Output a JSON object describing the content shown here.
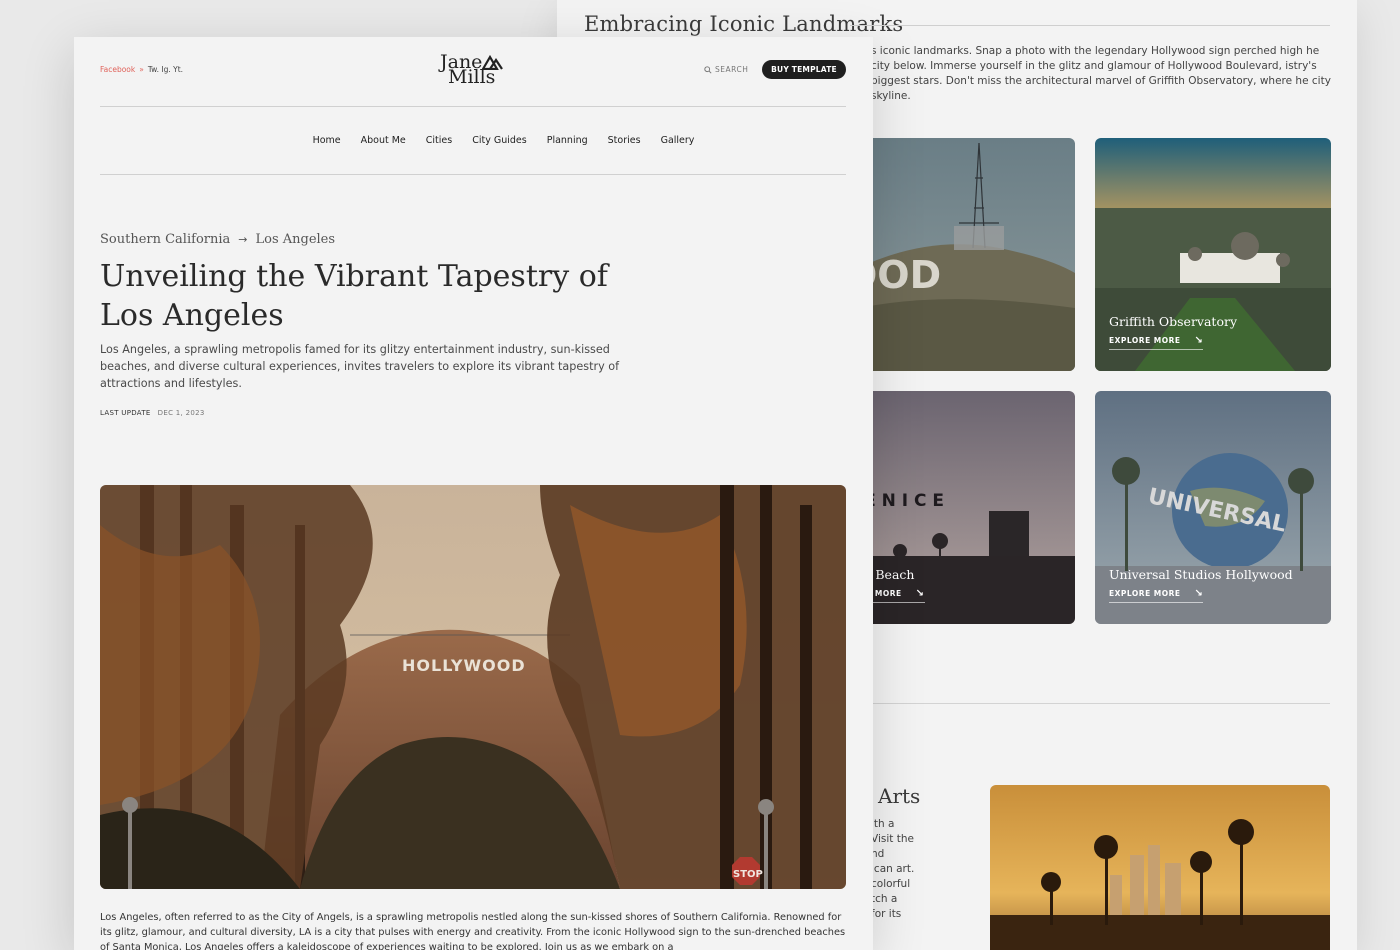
{
  "back": {
    "heading": "Embracing Iconic Landmarks",
    "paragraph": "s iconic landmarks. Snap a photo with the legendary Hollywood sign perched high he city below. Immerse yourself in the glitz and glamour of Hollywood Boulevard, istry's biggest stars. Don't miss the architectural marvel of Griffith Observatory, where he city skyline.",
    "cards": [
      {
        "title": "",
        "explore": ""
      },
      {
        "title": "Griffith Observatory",
        "explore": "EXPLORE MORE"
      },
      {
        "title": "ice Beach",
        "explore": "ORE MORE"
      },
      {
        "title": "Universal Studios Hollywood",
        "explore": "EXPLORE MORE"
      }
    ],
    "sign_text": "OOD",
    "venice_text": "V E N I C E",
    "universal_text": "UNIVERSAL",
    "arts_heading": "Arts",
    "arts_lines": [
      "ith a",
      "Visit the",
      "nd",
      "ican art.",
      "colorful",
      "tch a",
      "for its"
    ]
  },
  "front": {
    "social": {
      "facebook": "Facebook",
      "sep": "»",
      "others": "Tw. Ig. Yt."
    },
    "logo": {
      "line1": "Jane",
      "line2": "Mills"
    },
    "search_label": "SEARCH",
    "buy_label": "BUY TEMPLATE",
    "nav": [
      "Home",
      "About Me",
      "Cities",
      "City Guides",
      "Planning",
      "Stories",
      "Gallery"
    ],
    "breadcrumb": {
      "parent": "Southern California",
      "current": "Los Angeles"
    },
    "title": "Unveiling the Vibrant Tapestry of Los Angeles",
    "lead": "Los Angeles, a sprawling metropolis famed for its glitzy entertainment industry, sun-kissed beaches, and diverse cultural experiences, invites travelers to explore its vibrant tapestry of attractions and lifestyles.",
    "last_update_label": "LAST UPDATE",
    "last_update_date": "DEC 1, 2023",
    "hero_sign": "HOLLYWOOD",
    "hero_stop": "STOP",
    "body": "Los Angeles, often referred to as the City of Angels, is a sprawling metropolis nestled along the sun-kissed shores of Southern California. Renowned for its glitz, glamour, and cultural diversity, LA is a city that pulses with energy and creativity. From the iconic Hollywood sign to the sun-drenched beaches of Santa Monica, Los Angeles offers a kaleidoscope of experiences waiting to be explored. Join us as we embark on a"
  },
  "colors": {
    "accent": "#e0625a",
    "button": "#1f1f1f",
    "background": "#e9e9e9",
    "page": "#f3f3f3"
  }
}
